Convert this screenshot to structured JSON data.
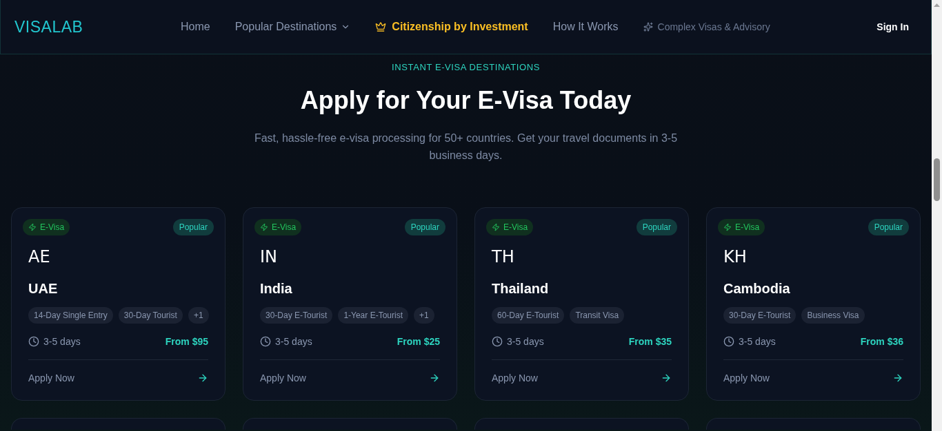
{
  "header": {
    "logo": "VISALAB",
    "nav": [
      {
        "label": "Home",
        "kind": "link"
      },
      {
        "label": "Popular Destinations",
        "kind": "dropdown"
      },
      {
        "label": "Citizenship by Investment",
        "kind": "featured"
      },
      {
        "label": "How It Works",
        "kind": "link"
      },
      {
        "label": "Complex Visas & Advisory",
        "kind": "secondary"
      }
    ],
    "sign_in": "Sign In"
  },
  "section": {
    "eyebrow": "INSTANT E-VISA DESTINATIONS",
    "title": "Apply for Your E-Visa Today",
    "subtitle": "Fast, hassle-free e-visa processing for 50+ countries. Get your travel documents in 3-5 business days."
  },
  "cards": [
    {
      "badge": "E-Visa",
      "label": "Popular",
      "code": "AE",
      "country": "UAE",
      "visa_types": [
        "14-Day Single Entry",
        "30-Day Tourist"
      ],
      "more": "+1",
      "processing": "3-5 days",
      "price": "From $95",
      "action": "Apply Now"
    },
    {
      "badge": "E-Visa",
      "label": "Popular",
      "code": "IN",
      "country": "India",
      "visa_types": [
        "30-Day E-Tourist",
        "1-Year E-Tourist"
      ],
      "more": "+1",
      "processing": "3-5 days",
      "price": "From $25",
      "action": "Apply Now"
    },
    {
      "badge": "E-Visa",
      "label": "Popular",
      "code": "TH",
      "country": "Thailand",
      "visa_types": [
        "60-Day E-Tourist",
        "Transit Visa"
      ],
      "processing": "3-5 days",
      "price": "From $35",
      "action": "Apply Now"
    },
    {
      "badge": "E-Visa",
      "label": "Popular",
      "code": "KH",
      "country": "Cambodia",
      "visa_types": [
        "30-Day E-Tourist",
        "Business Visa"
      ],
      "processing": "3-5 days",
      "price": "From $36",
      "action": "Apply Now"
    }
  ]
}
